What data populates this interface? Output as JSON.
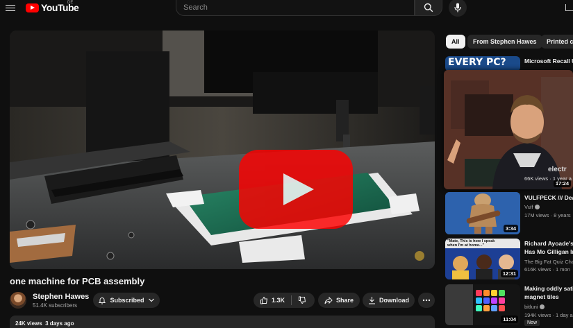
{
  "header": {
    "logo_text": "YouTube",
    "country": "DE",
    "search_placeholder": "Search"
  },
  "video": {
    "title": "one machine for PCB assembly",
    "channel": "Stephen Hawes",
    "subscribers": "51.4K subscribers",
    "subscribe_label": "Subscribed",
    "likes": "1.3K",
    "share_label": "Share",
    "download_label": "Download",
    "stats": "24K views  3 days ago"
  },
  "chips": [
    {
      "label": "All",
      "active": true
    },
    {
      "label": "From Stephen Hawes",
      "active": false
    },
    {
      "label": "Printed ci",
      "active": false
    }
  ],
  "recommendations": [
    {
      "title": "Microsoft Recall U",
      "thumb_text": "EVERY PC?",
      "preview_meta": "66K views · 1 year a",
      "duration": "17:24"
    },
    {
      "title": "VULFPECK /// Dea",
      "channel": "Vulf",
      "meta": "17M views · 8 years",
      "duration": "3:34"
    },
    {
      "title_line1": "Richard Ayoade's",
      "title_line2": "Has Mo Gilligan In",
      "channel": "The Big Fat Quiz Cha",
      "meta": "616K views · 1 mon",
      "thumb_text": "\"Mate, This is how I speak when I'm at home...\"",
      "duration": "12:31"
    },
    {
      "title_line1": "Making oddly sati",
      "title_line2": "magnet tiles",
      "channel": "bitluni",
      "meta": "194K views · 1 day ag",
      "badge": "New",
      "duration": "11:04"
    }
  ],
  "colors": {
    "background": "#0f0f0f",
    "brand_red": "#ff0000",
    "pill": "#272727",
    "pcb_green": "#1d7a5a"
  }
}
